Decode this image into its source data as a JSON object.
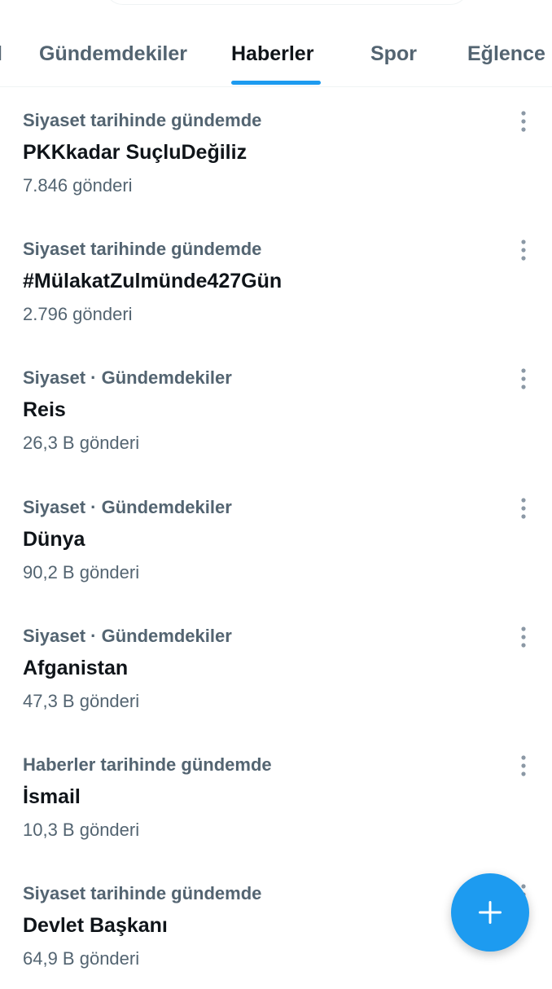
{
  "tabs": [
    {
      "label": "l",
      "active": false
    },
    {
      "label": "Gündemdekiler",
      "active": false
    },
    {
      "label": "Haberler",
      "active": true
    },
    {
      "label": "Spor",
      "active": false
    },
    {
      "label": "Eğlence",
      "active": false
    }
  ],
  "trends": [
    {
      "context": "Siyaset tarihinde gündemde",
      "name": "PKKkadar SuçluDeğiliz",
      "count": "7.846 gönderi"
    },
    {
      "context": "Siyaset tarihinde gündemde",
      "name": "#MülakatZulmünde427Gün",
      "count": "2.796 gönderi"
    },
    {
      "context": "Siyaset · Gündemdekiler",
      "name": "Reis",
      "count": "26,3 B gönderi"
    },
    {
      "context": "Siyaset · Gündemdekiler",
      "name": "Dünya",
      "count": "90,2 B gönderi"
    },
    {
      "context": "Siyaset · Gündemdekiler",
      "name": "Afganistan",
      "count": "47,3 B gönderi"
    },
    {
      "context": "Haberler tarihinde gündemde",
      "name": "İsmail",
      "count": "10,3 B gönderi"
    },
    {
      "context": "Siyaset tarihinde gündemde",
      "name": "Devlet Başkanı",
      "count": "64,9 B gönderi"
    }
  ],
  "icons": {
    "more": "more-vertical-icon",
    "compose": "plus-icon"
  },
  "colors": {
    "accent": "#1d9bf0",
    "primary_text": "#0f1419",
    "secondary_text": "#536471",
    "divider": "#eff3f4"
  }
}
